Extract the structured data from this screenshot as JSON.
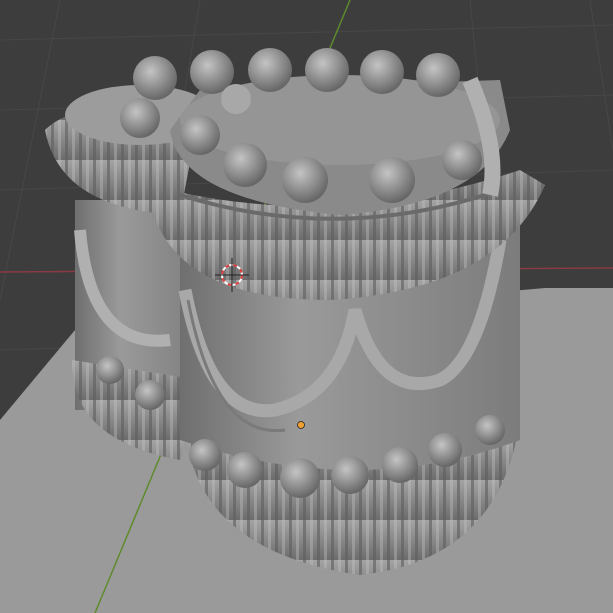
{
  "viewport": {
    "background": "#3d3d3d",
    "grid_color": "#474747",
    "x_axis_color": "#8a3a44",
    "y_axis_color": "#5f8a2c",
    "plane_color": "#9a9a9a",
    "cake_color": "#8e8e8e",
    "origin_color": "#f0a030",
    "cursor_colors": [
      "#e04040",
      "#ffffff"
    ]
  }
}
